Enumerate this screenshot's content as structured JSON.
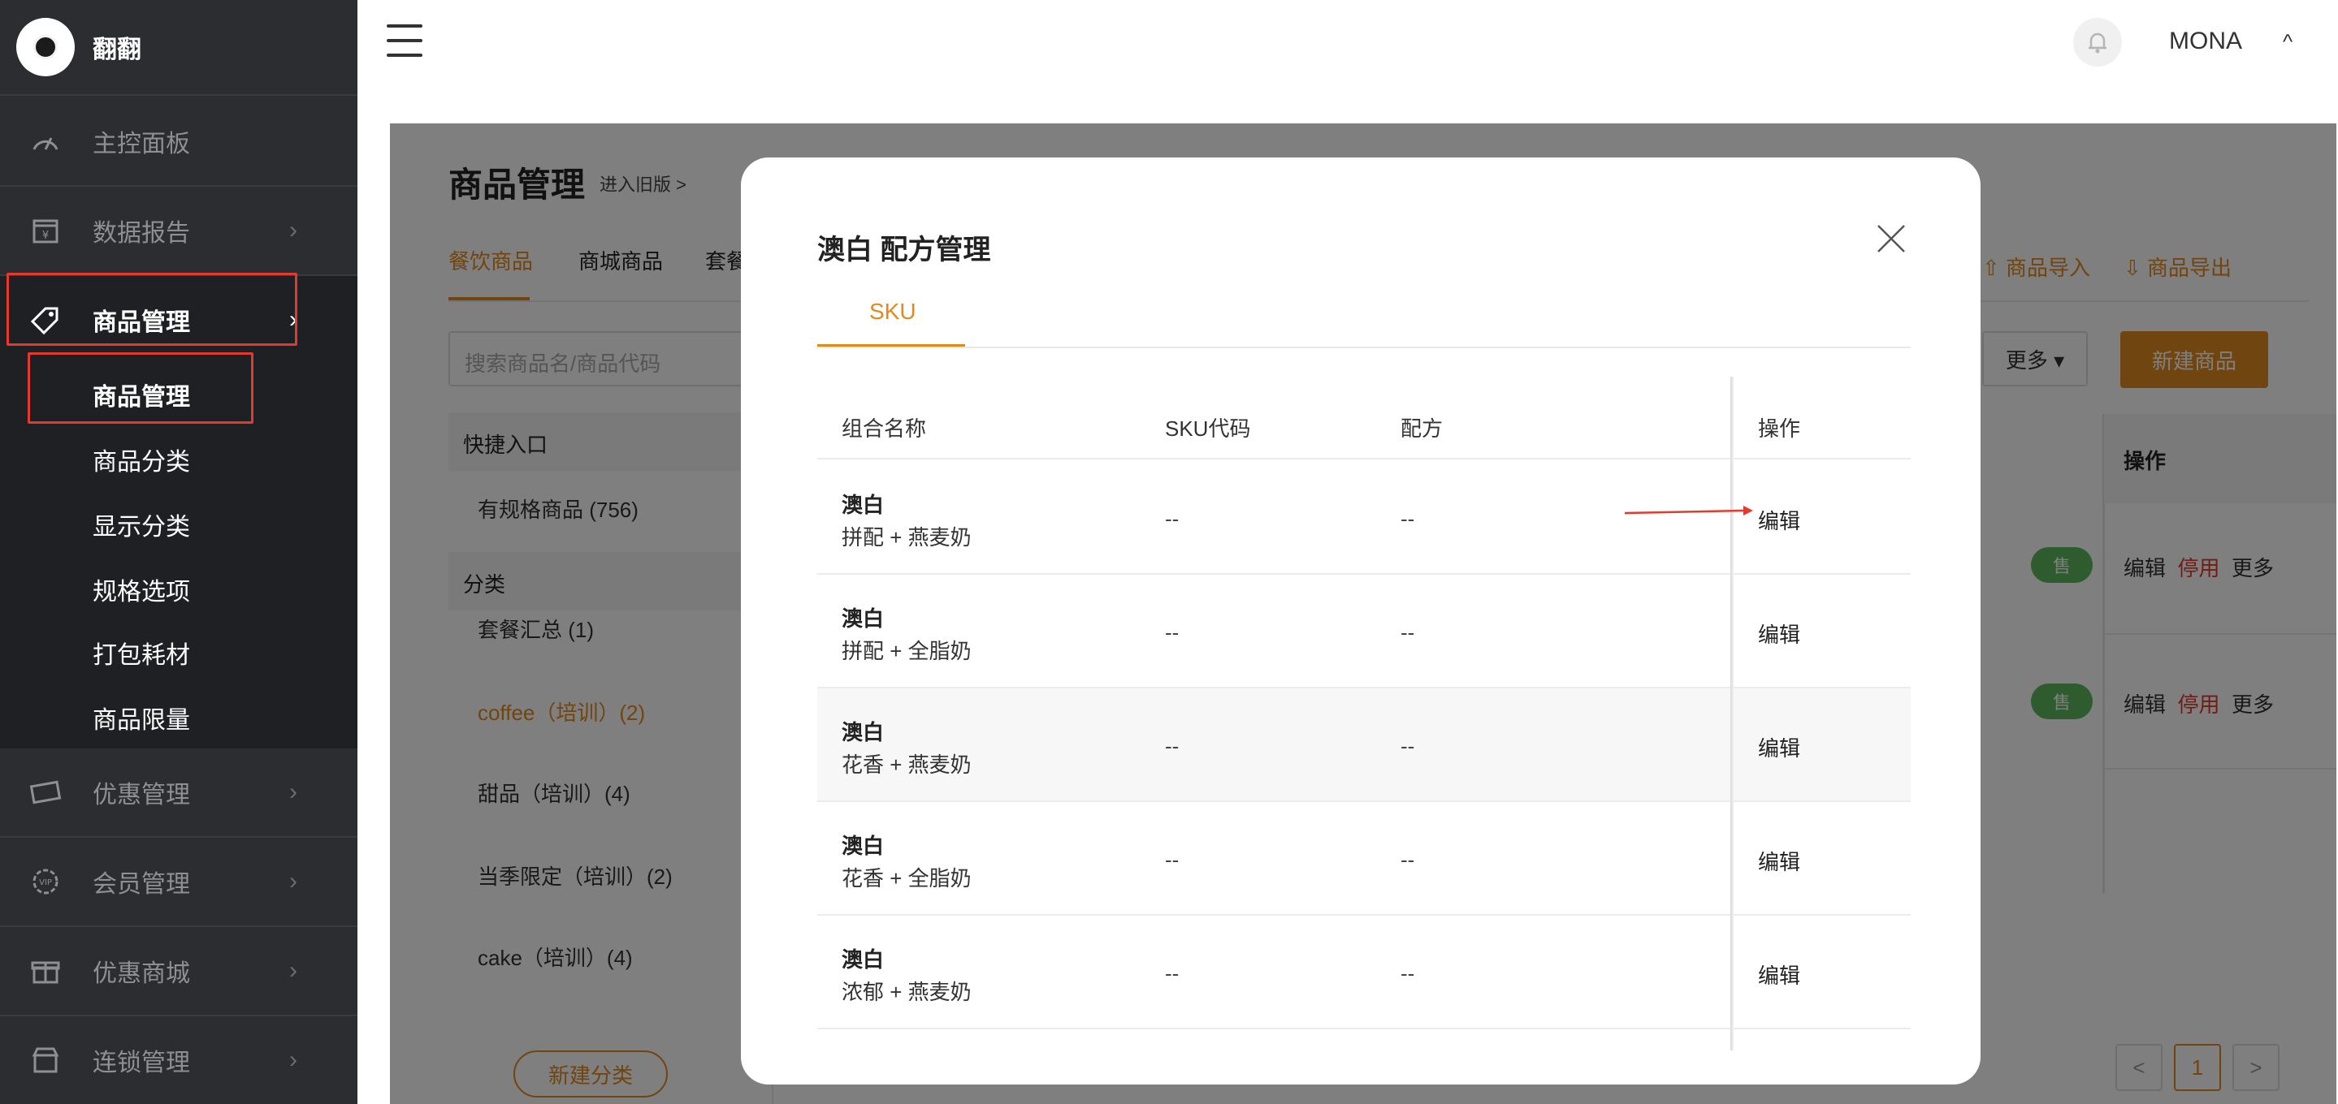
{
  "brand": {
    "name": "翻翻"
  },
  "sidebar": {
    "items": [
      {
        "label": "主控面板",
        "icon": "dashboard-icon"
      },
      {
        "label": "数据报告",
        "icon": "report-icon"
      },
      {
        "label": "商品管理",
        "icon": "tag-icon"
      },
      {
        "label": "优惠管理",
        "icon": "coupon-icon"
      },
      {
        "label": "会员管理",
        "icon": "vip-icon"
      },
      {
        "label": "优惠商城",
        "icon": "gift-icon"
      },
      {
        "label": "连锁管理",
        "icon": "store-icon"
      }
    ],
    "chevron": "›",
    "sub_items": [
      "商品管理",
      "商品分类",
      "显示分类",
      "规格选项",
      "打包耗材",
      "商品限量"
    ]
  },
  "topbar": {
    "username": "MONA",
    "caret": "^"
  },
  "page": {
    "title": "商品管理",
    "old_link": "进入旧版 >",
    "tabs": [
      "餐饮商品",
      "商城商品",
      "套餐"
    ],
    "import": "商品导入",
    "export": "商品导出",
    "search_placeholder": "搜索商品名/商品代码",
    "more": "更多 ▾",
    "new_goods": "新建商品",
    "left_panel": {
      "quick_entry": "快捷入口",
      "quick_items": [
        "有规格商品 (756)"
      ],
      "category": "分类",
      "categories": [
        "套餐汇总 (1)",
        "coffee（培训）(2)",
        "甜品（培训）(4)",
        "当季限定（培训）(2)",
        "cake（培训）(4)"
      ],
      "new_category": "新建分类"
    },
    "table": {
      "op_header": "操作",
      "status_badge": "售",
      "rows": [
        {
          "edit": "编辑",
          "stop": "停用",
          "more": "更多"
        },
        {
          "edit": "编辑",
          "stop": "停用",
          "more": "更多"
        }
      ]
    },
    "pager": {
      "prev": "<",
      "current": "1",
      "next": ">"
    }
  },
  "modal": {
    "title": "澳白 配方管理",
    "tab": "SKU",
    "columns": [
      "组合名称",
      "SKU代码",
      "配方",
      "操作"
    ],
    "rows": [
      {
        "name": "澳白",
        "combo": "拼配 + 燕麦奶",
        "sku": "--",
        "recipe": "--",
        "op": "编辑"
      },
      {
        "name": "澳白",
        "combo": "拼配 + 全脂奶",
        "sku": "--",
        "recipe": "--",
        "op": "编辑"
      },
      {
        "name": "澳白",
        "combo": "花香 + 燕麦奶",
        "sku": "--",
        "recipe": "--",
        "op": "编辑"
      },
      {
        "name": "澳白",
        "combo": "花香 + 全脂奶",
        "sku": "--",
        "recipe": "--",
        "op": "编辑"
      },
      {
        "name": "澳白",
        "combo": "浓郁 + 燕麦奶",
        "sku": "--",
        "recipe": "--",
        "op": "编辑"
      }
    ]
  },
  "colors": {
    "accent": "#e08a1e",
    "highlight": "#e4392d",
    "sidebar_bg": "#2c2d30"
  }
}
